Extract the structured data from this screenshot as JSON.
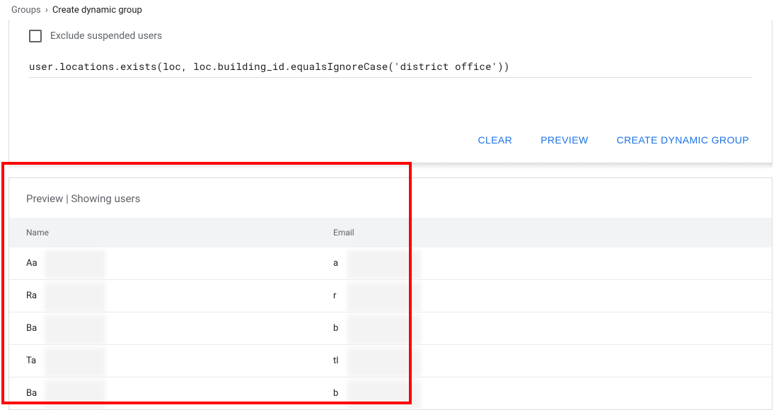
{
  "breadcrumb": {
    "parent": "Groups",
    "current": "Create dynamic group"
  },
  "form": {
    "exclude_label": "Exclude suspended users",
    "expression": "user.locations.exists(loc, loc.building_id.equalsIgnoreCase('district office'))"
  },
  "actions": {
    "clear": "CLEAR",
    "preview": "PREVIEW",
    "create": "CREATE DYNAMIC GROUP"
  },
  "preview": {
    "header": "Preview | Showing users",
    "columns": {
      "name": "Name",
      "email": "Email"
    },
    "rows": [
      {
        "name": "Aa",
        "email": "a"
      },
      {
        "name": "Ra",
        "email": "r"
      },
      {
        "name": "Ba",
        "email": "b"
      },
      {
        "name": "Ta",
        "email": "tl"
      },
      {
        "name": "Ba",
        "email": "b"
      }
    ]
  }
}
